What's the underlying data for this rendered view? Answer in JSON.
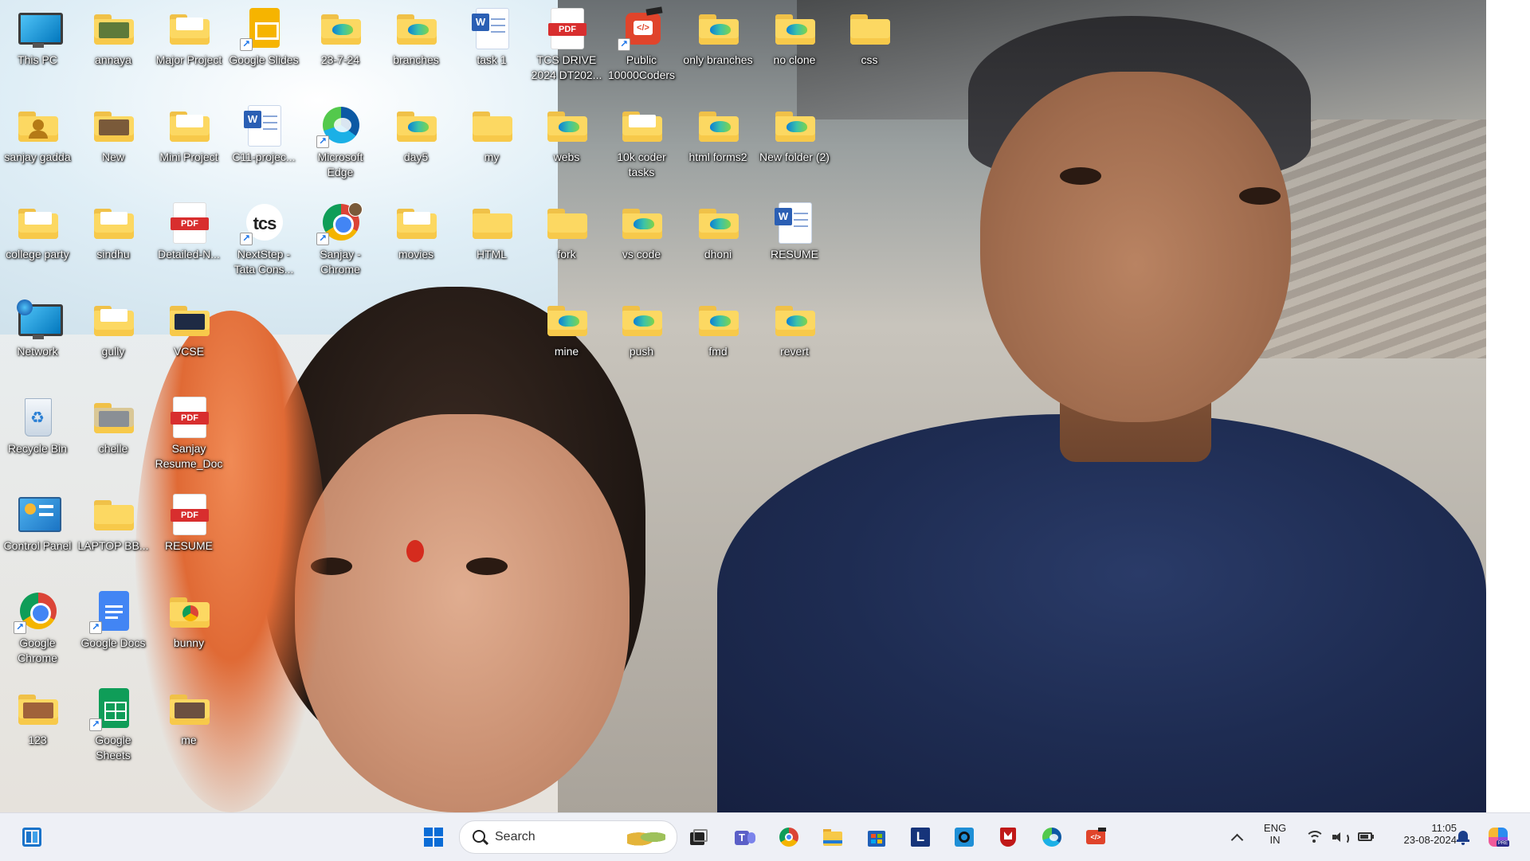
{
  "desktop": {
    "icons": [
      {
        "label": "This PC"
      },
      {
        "label": "annaya"
      },
      {
        "label": "Major Project"
      },
      {
        "label": "Google Slides"
      },
      {
        "label": "23-7-24"
      },
      {
        "label": "branches"
      },
      {
        "label": "task 1"
      },
      {
        "label": "TCS DRIVE 2024 DT202..."
      },
      {
        "label": "Public 10000Coders"
      },
      {
        "label": "only branches"
      },
      {
        "label": "no clone"
      },
      {
        "label": "css"
      },
      {
        "label": "sanjay gadda"
      },
      {
        "label": "New"
      },
      {
        "label": "Mini Project"
      },
      {
        "label": "C11-projec..."
      },
      {
        "label": "Microsoft Edge"
      },
      {
        "label": "day5"
      },
      {
        "label": "my"
      },
      {
        "label": "webs"
      },
      {
        "label": "10k coder tasks"
      },
      {
        "label": "html forms2"
      },
      {
        "label": "New folder (2)"
      },
      {
        "label": "college party"
      },
      {
        "label": "sindhu"
      },
      {
        "label": "Detailed-N..."
      },
      {
        "label": "NextStep - Tata Cons..."
      },
      {
        "label": "Sanjay - Chrome"
      },
      {
        "label": "movies"
      },
      {
        "label": "HTML"
      },
      {
        "label": "fork"
      },
      {
        "label": "vs code"
      },
      {
        "label": "dhoni"
      },
      {
        "label": "RESUME"
      },
      {
        "label": "Network"
      },
      {
        "label": "gully"
      },
      {
        "label": "VCSE"
      },
      {
        "label": "mine"
      },
      {
        "label": "push"
      },
      {
        "label": "fmd"
      },
      {
        "label": "revert"
      },
      {
        "label": "Recycle Bin"
      },
      {
        "label": "chelle"
      },
      {
        "label": "Sanjay Resume_Doc"
      },
      {
        "label": "Control Panel"
      },
      {
        "label": "LAPTOP BB..."
      },
      {
        "label": "RESUME"
      },
      {
        "label": "Google Chrome"
      },
      {
        "label": "Google Docs"
      },
      {
        "label": "bunny"
      },
      {
        "label": "123"
      },
      {
        "label": "Google Sheets"
      },
      {
        "label": "me"
      }
    ]
  },
  "taskbar": {
    "search_placeholder": "Search",
    "apps": [
      "widgets",
      "start",
      "search",
      "task-view",
      "teams",
      "chrome",
      "file-explorer",
      "microsoft-store",
      "l-app",
      "cortana",
      "mcafee",
      "edge",
      "dev-tool"
    ],
    "tray": {
      "lang_top": "ENG",
      "lang_bottom": "IN",
      "time": "11:05",
      "date": "23-08-2024"
    }
  },
  "colors": {
    "taskbar_bg": "#eef0f6",
    "folder_yellow": "#fcd862",
    "win_blue": "#0a6cd6"
  }
}
